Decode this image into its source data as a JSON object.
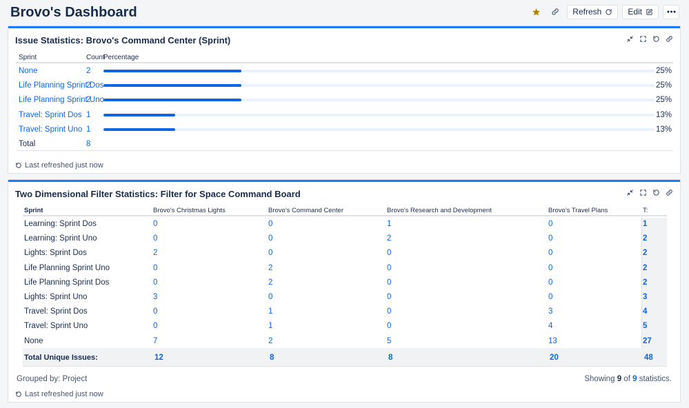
{
  "header": {
    "title": "Brovo's Dashboard",
    "refresh_label": "Refresh",
    "edit_label": "Edit",
    "star_color": "#b38600"
  },
  "panel1": {
    "title": "Issue Statistics: Brovo's Command Center (Sprint)",
    "columns": {
      "sprint": "Sprint",
      "count": "Count",
      "percentage": "Percentage"
    },
    "rows": [
      {
        "name": "None",
        "count": "2",
        "pct": "25%",
        "fraction": 0.25
      },
      {
        "name": "Life Planning Sprint Dos",
        "count": "2",
        "pct": "25%",
        "fraction": 0.25
      },
      {
        "name": "Life Planning Sprint Uno",
        "count": "2",
        "pct": "25%",
        "fraction": 0.25
      },
      {
        "name": "Travel: Sprint Dos",
        "count": "1",
        "pct": "13%",
        "fraction": 0.13
      },
      {
        "name": "Travel: Sprint Uno",
        "count": "1",
        "pct": "13%",
        "fraction": 0.13
      }
    ],
    "total_label": "Total",
    "total_count": "8",
    "refreshed": "Last refreshed just now"
  },
  "panel2": {
    "title": "Two Dimensional Filter Statistics: Filter for Space Command Board",
    "columns": [
      "Sprint",
      "Brovo's Christmas Lights",
      "Brovo's Command Center",
      "Brovo's Research and Development",
      "Brovo's Travel Plans",
      "T:"
    ],
    "rows": [
      {
        "name": "Learning: Sprint Dos",
        "values": [
          "0",
          "0",
          "1",
          "0"
        ],
        "total": "1"
      },
      {
        "name": "Learning: Sprint Uno",
        "values": [
          "0",
          "0",
          "2",
          "0"
        ],
        "total": "2"
      },
      {
        "name": "Lights: Sprint Dos",
        "values": [
          "2",
          "0",
          "0",
          "0"
        ],
        "total": "2"
      },
      {
        "name": "Life Planning Sprint Uno",
        "values": [
          "0",
          "2",
          "0",
          "0"
        ],
        "total": "2"
      },
      {
        "name": "Life Planning Sprint Dos",
        "values": [
          "0",
          "2",
          "0",
          "0"
        ],
        "total": "2"
      },
      {
        "name": "Lights: Sprint Uno",
        "values": [
          "3",
          "0",
          "0",
          "0"
        ],
        "total": "3"
      },
      {
        "name": "Travel: Sprint Dos",
        "values": [
          "0",
          "1",
          "0",
          "3"
        ],
        "total": "4"
      },
      {
        "name": "Travel: Sprint Uno",
        "values": [
          "0",
          "1",
          "0",
          "4"
        ],
        "total": "5"
      },
      {
        "name": "None",
        "values": [
          "7",
          "2",
          "5",
          "13"
        ],
        "total": "27"
      }
    ],
    "total_row": {
      "name": "Total Unique Issues:",
      "values": [
        "12",
        "8",
        "8",
        "20"
      ],
      "total": "48"
    },
    "grouped_by": "Grouped by: Project",
    "showing": {
      "prefix": "Showing",
      "count": "9",
      "of": "of",
      "total": "9",
      "suffix": "statistics."
    },
    "refreshed": "Last refreshed just now"
  }
}
